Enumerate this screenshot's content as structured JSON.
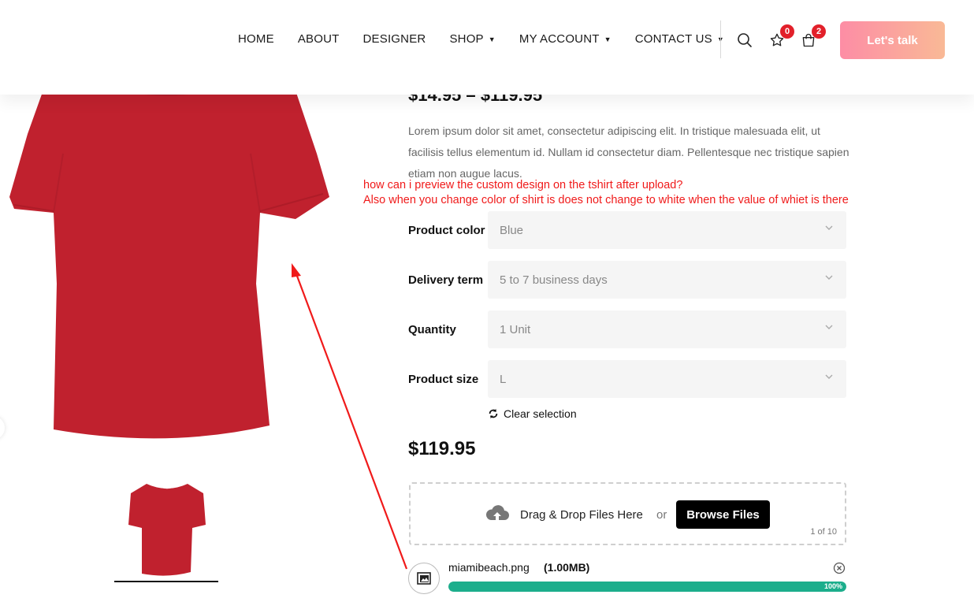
{
  "nav": {
    "items": [
      {
        "label": "HOME",
        "dropdown": false
      },
      {
        "label": "ABOUT",
        "dropdown": false
      },
      {
        "label": "DESIGNER",
        "dropdown": false
      },
      {
        "label": "SHOP",
        "dropdown": true
      },
      {
        "label": "MY ACCOUNT",
        "dropdown": true
      },
      {
        "label": "CONTACT US",
        "dropdown": true
      }
    ],
    "wishlist_count": "0",
    "cart_count": "2",
    "cta_label": "Let's talk"
  },
  "product": {
    "price_range": "$14.95 – $119.95",
    "description": "Lorem ipsum dolor sit amet, consectetur adipiscing elit. In tristique malesuada elit, ut facilisis tellus elementum id. Nullam id consectetur diam. Pellentesque nec tristique sapien etiam non augue lacus.",
    "shirt_color": "#c0212e",
    "options": [
      {
        "label": "Product color",
        "value": "Blue"
      },
      {
        "label": "Delivery term",
        "value": "5 to 7 business days"
      },
      {
        "label": "Quantity",
        "value": "1 Unit"
      },
      {
        "label": "Product size",
        "value": "L"
      }
    ],
    "clear_label": "Clear selection",
    "price": "$119.95"
  },
  "annotations": {
    "line1": "how can i preview the custom design on the tshirt after upload?",
    "line2": "Also when you change color of shirt is does not change to white when the value of whiet is there",
    "color": "#f01a1a"
  },
  "upload": {
    "drag_text": "Drag & Drop Files Here",
    "or_text": "or",
    "browse_label": "Browse Files",
    "count": "1 of 10",
    "file_name": "miamibeach.png",
    "file_size": "(1.00MB)",
    "progress": 1.0,
    "progress_label": "100%",
    "progress_color": "#1cae8c"
  }
}
